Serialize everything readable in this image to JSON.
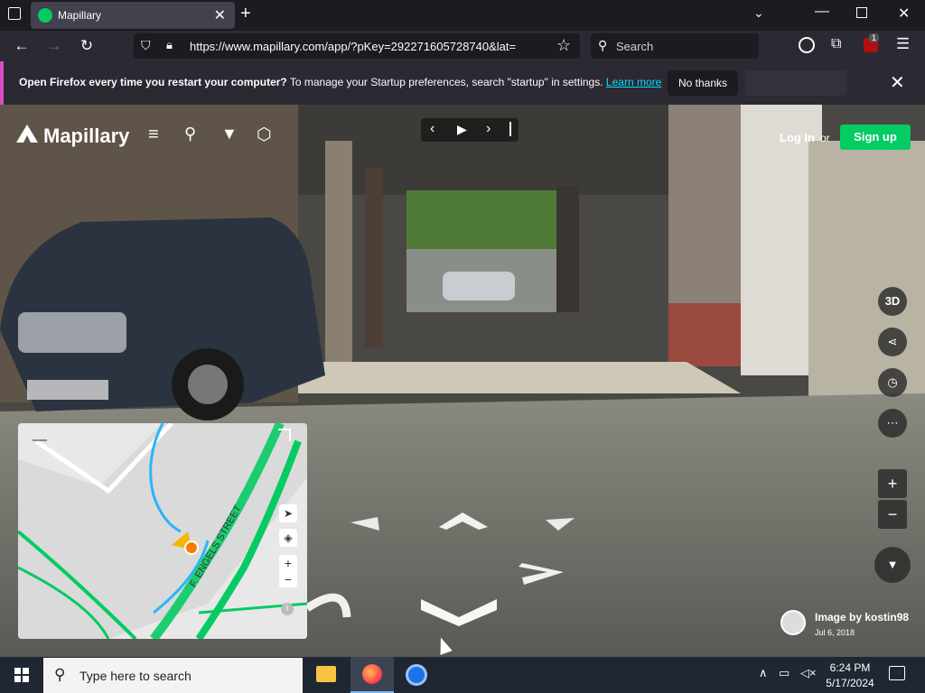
{
  "browser": {
    "tab_title": "Mapillary",
    "url": "https://www.mapillary.com/app/?pKey=292271605728740&lat=",
    "search_placeholder": "Search",
    "badge": "1"
  },
  "notification": {
    "bold": "Open Firefox every time you restart your computer?",
    "text": " To manage your Startup preferences, search \"startup\" in settings.",
    "link": "Learn more",
    "button": "No thanks"
  },
  "mapillary": {
    "brand": "Mapillary",
    "login": "Log In",
    "or": "or",
    "signup": "Sign up",
    "btn_3d": "3D",
    "author": "Image by kostin98",
    "date": "Jul 6, 2018",
    "street": "F. ENGELS STREET"
  },
  "taskbar": {
    "search": "Type here to search",
    "time": "6:24 PM",
    "date": "5/17/2024"
  },
  "colors": {
    "mapillary_green": "#05cb63",
    "firefox_accent": "#d84ec1",
    "link": "#00ddff"
  }
}
